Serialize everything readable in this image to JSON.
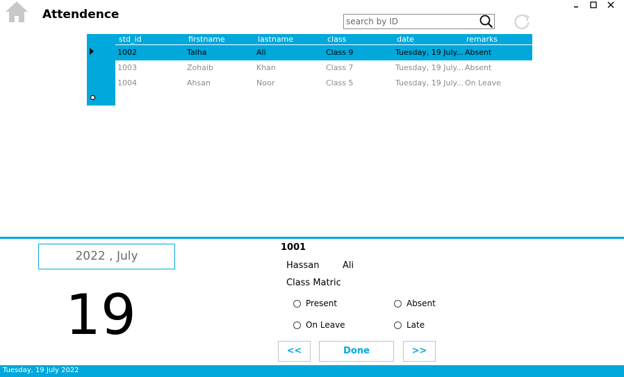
{
  "window": {
    "title": "Attendence"
  },
  "search": {
    "placeholder": "search by ID",
    "value": ""
  },
  "grid": {
    "columns": [
      "std_id",
      "firstname",
      "lastname",
      "class",
      "date",
      "remarks"
    ],
    "rows": [
      {
        "std_id": "1002",
        "firstname": "Talha",
        "lastname": "Ali",
        "class": "Class 9",
        "date": "Tuesday, 19 July...",
        "remarks": "Absent",
        "selected": true
      },
      {
        "std_id": "1003",
        "firstname": "Zohaib",
        "lastname": "Khan",
        "class": "Class 7",
        "date": "Tuesday, 19 July...",
        "remarks": "Absent",
        "selected": false
      },
      {
        "std_id": "1004",
        "firstname": "Ahsan",
        "lastname": "Noor",
        "class": "Class 5",
        "date": "Tuesday, 19 July...",
        "remarks": "On Leave",
        "selected": false
      }
    ]
  },
  "calendar": {
    "year_month": "2022 , July",
    "day": "19"
  },
  "student": {
    "id": "1001",
    "firstname": "Hassan",
    "lastname": "Ali",
    "class": "Class Matric"
  },
  "attendance_options": {
    "present": "Present",
    "absent": "Absent",
    "on_leave": "On Leave",
    "late": "Late",
    "selected": null
  },
  "buttons": {
    "prev": "<<",
    "done": "Done",
    "next": ">>"
  },
  "status_bar": {
    "text": "Tuesday, 19 July 2022"
  },
  "colors": {
    "accent": "#00a8dc",
    "muted_text": "#8a8a8a",
    "home_icon": "#c8c8c8"
  },
  "icons": {
    "home": "home-icon",
    "search": "search-icon",
    "refresh": "refresh-icon",
    "minimize": "minimize-icon",
    "maximize": "maximize-icon",
    "close": "close-icon"
  }
}
